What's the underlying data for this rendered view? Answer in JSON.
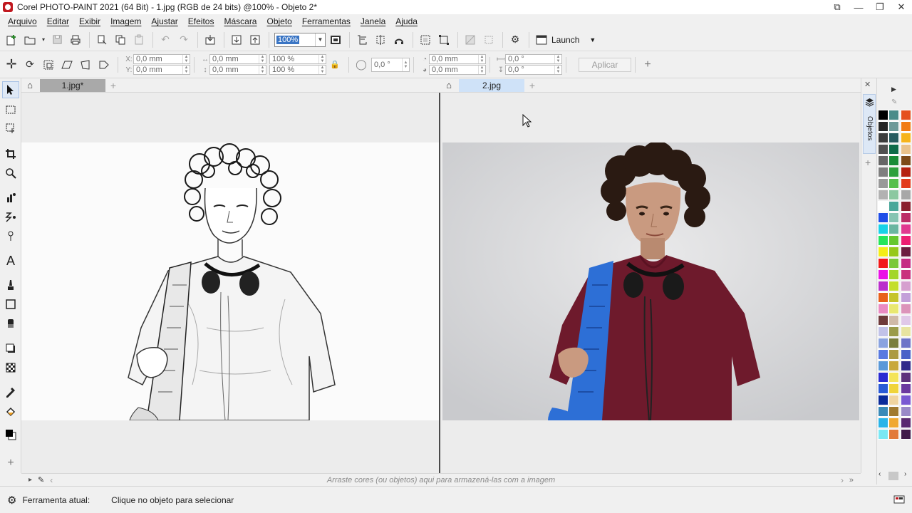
{
  "window": {
    "title": "Corel PHOTO-PAINT 2021 (64 Bit) - 1.jpg (RGB de 24 bits) @100% - Objeto 2*",
    "controls": [
      "restore-down",
      "minimize",
      "maximize",
      "close"
    ]
  },
  "menu": [
    "Arquivo",
    "Editar",
    "Exibir",
    "Imagem",
    "Ajustar",
    "Efeitos",
    "Máscara",
    "Objeto",
    "Ferramentas",
    "Janela",
    "Ajuda"
  ],
  "toolbar": {
    "zoom_value": "100%",
    "launch_label": "Launch"
  },
  "property_bar": {
    "x_label": "X:",
    "y_label": "Y:",
    "x_value": "0,0 mm",
    "y_value": "0,0 mm",
    "w_value": "0,0 mm",
    "h_value": "0,0 mm",
    "scale_w": "100 %",
    "scale_h": "100 %",
    "rotation": "0,0 °",
    "center_x": "0,0 mm",
    "center_y": "0,0 mm",
    "skew_h": "0,0 °",
    "skew_v": "0,0 °",
    "apply_label": "Aplicar"
  },
  "documents": {
    "left_tab": "1.jpg*",
    "right_tab": "2.jpg"
  },
  "dockers": {
    "objects_label": "Objetos"
  },
  "colors": {
    "accent_blue": "#3a75c4",
    "tab_active_bg": "#cfe2f8",
    "tab_inactive_bg": "#a9a9a9",
    "shirt": "#6e1a2c",
    "backpack_strap": "#2d6fd6",
    "palette": [
      "#000000",
      "#4a8c8a",
      "#e5501e",
      "#262626",
      "#6d9a99",
      "#f17c14",
      "#3c3c3c",
      "#275b5f",
      "#f6b41c",
      "#505050",
      "#0d6b49",
      "#e9c28b",
      "#666666",
      "#198c37",
      "#7d4a18",
      "#7f7f7f",
      "#2ea03c",
      "#b5200f",
      "#999999",
      "#55bf4c",
      "#e23b1b",
      "#b2b2b2",
      "#8cc8a0",
      "#a7a7a7",
      "#ffffff",
      "#4aa79a",
      "#8a1f2d",
      "#1f4ee8",
      "#86c4b2",
      "#bc2d66",
      "#18d2e8",
      "#6ab6a0",
      "#e0398f",
      "#25e55b",
      "#66c72e",
      "#ec1f72",
      "#f4ee17",
      "#96c81a",
      "#6c1e3f",
      "#f21a1a",
      "#7ac83a",
      "#c52d83",
      "#ea12e6",
      "#a3d629",
      "#c9307d",
      "#ba2fcb",
      "#c4de2b",
      "#d6a0cf",
      "#e8601a",
      "#c5c42a",
      "#c3a0d9",
      "#ea8ac2",
      "#e9e870",
      "#dc94ba",
      "#6e3a3a",
      "#cfb9a7",
      "#e0c8e8",
      "#c1c2e8",
      "#9b9b4a",
      "#e8e4a0",
      "#8aa3e0",
      "#7a7e3c",
      "#6e75c8",
      "#5a7ae0",
      "#ac9a42",
      "#4a62c8",
      "#5a98d8",
      "#c8a83c",
      "#302a8a",
      "#2a2ad2",
      "#f4e45a",
      "#5e327d",
      "#2a5ad6",
      "#f0d43a",
      "#6c3aa0",
      "#0a2a9a",
      "#f0d4a0",
      "#7a5ad2",
      "#3a8ab8",
      "#a07a30",
      "#9a8ac8",
      "#2ab4e8",
      "#f0a830",
      "#5a2a70",
      "#7ae8f4",
      "#e27a3a",
      "#401a4a"
    ]
  },
  "colorbar": {
    "hint": "Arraste cores (ou objetos) aqui para armazená-las com a imagem"
  },
  "status": {
    "label": "Ferramenta atual:",
    "value": "Clique no objeto para selecionar"
  }
}
